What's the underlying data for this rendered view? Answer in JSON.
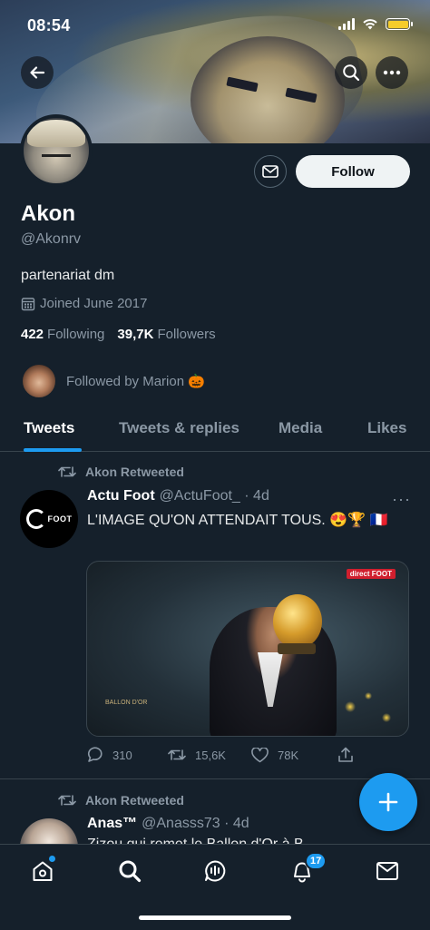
{
  "status_bar": {
    "time": "08:54"
  },
  "profile": {
    "name": "Akon",
    "handle": "@Akonrv",
    "bio": "partenariat dm",
    "joined": "Joined June 2017",
    "following_count": "422",
    "following_label": "Following",
    "followers_count": "39,7K",
    "followers_label": "Followers",
    "followed_by": "Followed by Marion 🎃",
    "follow_button": "Follow"
  },
  "tabs": [
    {
      "label": "Tweets",
      "active": true
    },
    {
      "label": "Tweets & replies"
    },
    {
      "label": "Media"
    },
    {
      "label": "Likes"
    }
  ],
  "tweets": [
    {
      "retweet_label": "Akon Retweeted",
      "author_name": "Actu Foot",
      "author_handle": "@ActuFoot_ · 4d",
      "avatar_text": "FOOT",
      "text": "L'IMAGE QU'ON ATTENDAIT TOUS. 😍🏆 🇫🇷",
      "media_logo": "BALLON D'OR",
      "media_badge": "direct FOOT",
      "replies": "310",
      "retweets": "15,6K",
      "likes": "78K"
    },
    {
      "retweet_label": "Akon Retweeted",
      "author_name": "Anas™",
      "author_handle": "@Anasss73 · 4d",
      "text": "Zizou qui remet le Ballon d'Or à B"
    }
  ],
  "notifications_badge": "17",
  "icons": [
    "back-arrow-icon",
    "search-icon",
    "more-icon",
    "mail-icon",
    "calendar-icon",
    "retweet-icon",
    "reply-icon",
    "heart-icon",
    "share-icon",
    "plus-icon",
    "home-icon",
    "spaces-icon",
    "bell-icon"
  ],
  "colors": {
    "background": "#15202b",
    "accent": "#1d9bf0",
    "muted": "#8b98a5"
  }
}
